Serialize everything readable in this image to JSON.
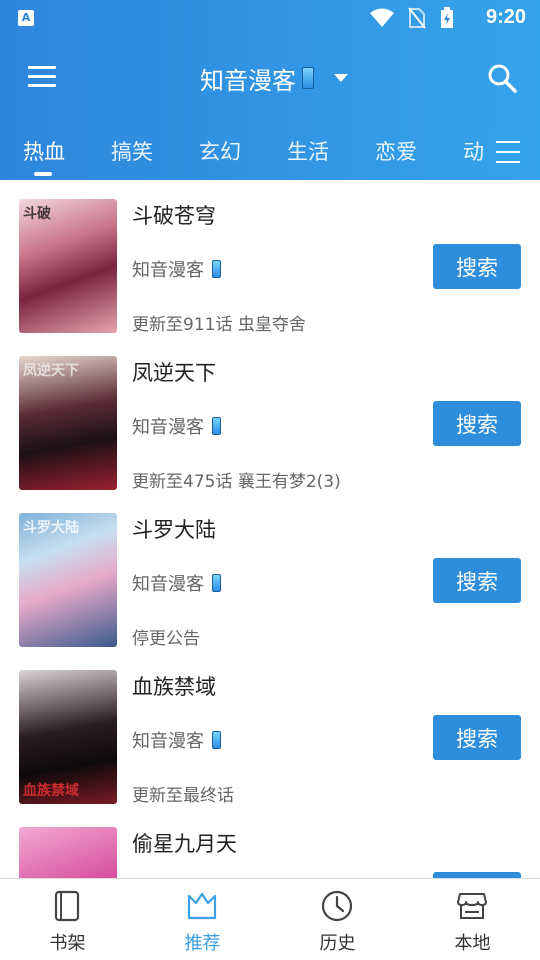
{
  "status_bar": {
    "time": "9:20",
    "app_icon_letter": "A"
  },
  "toolbar": {
    "title": "知音漫客"
  },
  "tabs": [
    {
      "label": "热血",
      "active": true
    },
    {
      "label": "搞笑",
      "active": false
    },
    {
      "label": "玄幻",
      "active": false
    },
    {
      "label": "生活",
      "active": false
    },
    {
      "label": "恋爱",
      "active": false
    },
    {
      "label": "动",
      "active": false
    }
  ],
  "comics": [
    {
      "name": "斗破苍穹",
      "source": "知音漫客",
      "update": "更新至911话 虫皇夺舍",
      "button": "搜索",
      "cover_text": "斗破"
    },
    {
      "name": "凤逆天下",
      "source": "知音漫客",
      "update": "更新至475话 襄王有梦2(3)",
      "button": "搜索",
      "cover_text": "凤逆天下"
    },
    {
      "name": "斗罗大陆",
      "source": "知音漫客",
      "update": "停更公告",
      "button": "搜索",
      "cover_text": "斗罗大陆"
    },
    {
      "name": "血族禁域",
      "source": "知音漫客",
      "update": "更新至最终话",
      "button": "搜索",
      "cover_text": "血族禁域"
    },
    {
      "name": "偷星九月天",
      "source": "",
      "update": "",
      "button": "",
      "cover_text": ""
    }
  ],
  "bottom_nav": [
    {
      "label": "书架",
      "icon": "book-icon",
      "active": false
    },
    {
      "label": "推荐",
      "icon": "crown-icon",
      "active": true
    },
    {
      "label": "历史",
      "icon": "clock-icon",
      "active": false
    },
    {
      "label": "本地",
      "icon": "store-icon",
      "active": false
    }
  ],
  "colors": {
    "header_start": "#2e86dc",
    "header_end": "#35a3ea",
    "button": "#2f8edc",
    "nav_active": "#3aa0e8"
  }
}
